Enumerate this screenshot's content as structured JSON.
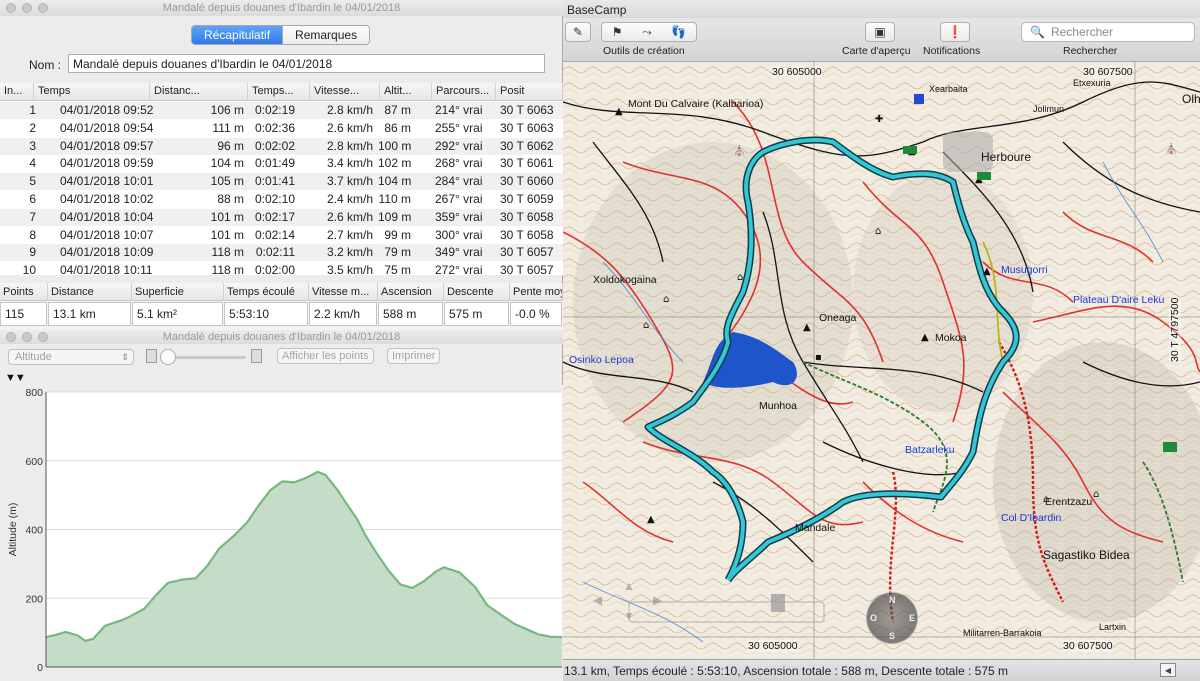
{
  "props": {
    "window_title": "Mandalé depuis douanes d'Ibardin le 04/01/2018",
    "tabs": [
      {
        "label": "Récapitulatif",
        "active": true
      },
      {
        "label": "Remarques",
        "active": false
      }
    ],
    "name_label": "Nom :",
    "name_value": "Mandalé depuis douanes d'Ibardin le 04/01/2018",
    "columns": [
      "In...",
      "Temps",
      "Distanc...",
      "Temps...",
      "Vitesse...",
      "Altit...",
      "Parcours...",
      "Posit"
    ],
    "rows": [
      [
        "1",
        "04/01/2018 09:52",
        "106 m",
        "0:02:19",
        "2.8 km/h",
        "87 m",
        "214° vrai",
        "30 T 6063"
      ],
      [
        "2",
        "04/01/2018 09:54",
        "111 m",
        "0:02:36",
        "2.6 km/h",
        "86 m",
        "255° vrai",
        "30 T 6063"
      ],
      [
        "3",
        "04/01/2018 09:57",
        "96 m",
        "0:02:02",
        "2.8 km/h",
        "100 m",
        "292° vrai",
        "30 T 6062"
      ],
      [
        "4",
        "04/01/2018 09:59",
        "104 m",
        "0:01:49",
        "3.4 km/h",
        "102 m",
        "268° vrai",
        "30 T 6061"
      ],
      [
        "5",
        "04/01/2018 10:01",
        "105 m",
        "0:01:41",
        "3.7 km/h",
        "104 m",
        "284° vrai",
        "30 T 6060"
      ],
      [
        "6",
        "04/01/2018 10:02",
        "88 m",
        "0:02:10",
        "2.4 km/h",
        "110 m",
        "267° vrai",
        "30 T 6059"
      ],
      [
        "7",
        "04/01/2018 10:04",
        "101 m",
        "0:02:17",
        "2.6 km/h",
        "109 m",
        "359° vrai",
        "30 T 6058"
      ],
      [
        "8",
        "04/01/2018 10:07",
        "101 m",
        "0:02:14",
        "2.7 km/h",
        "99 m",
        "300° vrai",
        "30 T 6058"
      ],
      [
        "9",
        "04/01/2018 10:09",
        "118 m",
        "0:02:11",
        "3.2 km/h",
        "79 m",
        "349° vrai",
        "30 T 6057"
      ],
      [
        "10",
        "04/01/2018 10:11",
        "118 m",
        "0:02:00",
        "3.5 km/h",
        "75 m",
        "272° vrai",
        "30 T 6057"
      ]
    ],
    "summary": {
      "headers": [
        "Points",
        "Distance",
        "Superficie",
        "Temps écoulé",
        "Vitesse m...",
        "Ascension",
        "Descente",
        "Pente moy"
      ],
      "values": [
        "115",
        "13.1 km",
        "5.1 km²",
        "5:53:10",
        "2.2 km/h",
        "588 m",
        "575 m",
        "-0.0 %"
      ]
    }
  },
  "profile": {
    "window_title": "Mandalé depuis douanes d'Ibardin le 04/01/2018",
    "select_value": "Altitude",
    "buttons": [
      "Afficher les points",
      "Imprimer"
    ],
    "markers": "▼▼",
    "chart_data": {
      "type": "area",
      "ylabel": "Altitude (m)",
      "ylim": [
        0,
        800
      ],
      "yticks": [
        "800",
        "600",
        "400",
        "200",
        "0"
      ],
      "grid": true,
      "color": "#74b97f",
      "fill": "#c5ddc8",
      "series": [
        {
          "x": [
            0,
            0.2,
            0.5,
            0.8,
            1.0,
            1.2,
            1.5,
            1.9,
            2.1,
            2.5,
            2.8,
            3.1,
            3.5,
            3.8,
            4.1,
            4.4,
            4.8,
            5.1,
            5.4,
            5.7,
            6.0,
            6.3,
            6.6,
            6.9,
            7.1,
            7.4,
            7.6,
            7.9,
            8.1,
            8.4,
            8.7,
            9.0,
            9.3,
            9.6,
            9.9,
            10.1,
            10.5,
            10.9,
            11.2,
            11.6,
            11.9,
            12.2,
            12.5,
            12.8,
            13.1
          ],
          "y": [
            87,
            92,
            102,
            92,
            76,
            82,
            120,
            135,
            145,
            170,
            210,
            245,
            255,
            258,
            295,
            345,
            385,
            420,
            470,
            515,
            540,
            537,
            550,
            568,
            558,
            515,
            480,
            430,
            385,
            330,
            280,
            240,
            230,
            250,
            278,
            290,
            275,
            232,
            180,
            148,
            125,
            110,
            95,
            88,
            87
          ]
        }
      ]
    }
  },
  "map": {
    "window_title": "BaseCamp",
    "toolbar": {
      "tools_label": "Outils de création",
      "overview_label": "Carte d'aperçu",
      "notifications_label": "Notifications",
      "search_placeholder": "Rechercher",
      "search_label": "Rechercher"
    },
    "grid_labels": [
      "30 605000",
      "30 607500",
      "30 605000",
      "30 607500",
      "30 T 4797500"
    ],
    "places": [
      "Mont Du Calvaire (Kalbarioa)",
      "Herboure",
      "Xoldokogaina",
      "Oneaga",
      "Mokoa",
      "Osinko Lepoa",
      "Munhoa",
      "Batzarleku",
      "Erentzazu",
      "Col D'Ibardin",
      "Sagastiko Bidea",
      "Mandale",
      "Xearbaita",
      "Jolimun",
      "Etxexuria",
      "Lartxin",
      "Militarren-Barrakoia",
      "Olh"
    ],
    "blue_places": [
      "Musugorri",
      "Plateau D'aire Leku"
    ],
    "compass_dirs": [
      "N",
      "O",
      "E",
      "S"
    ],
    "status": "13.1 km, Temps écoulé : 5:53:10, Ascension totale : 588 m, Descente totale : 575 m"
  }
}
